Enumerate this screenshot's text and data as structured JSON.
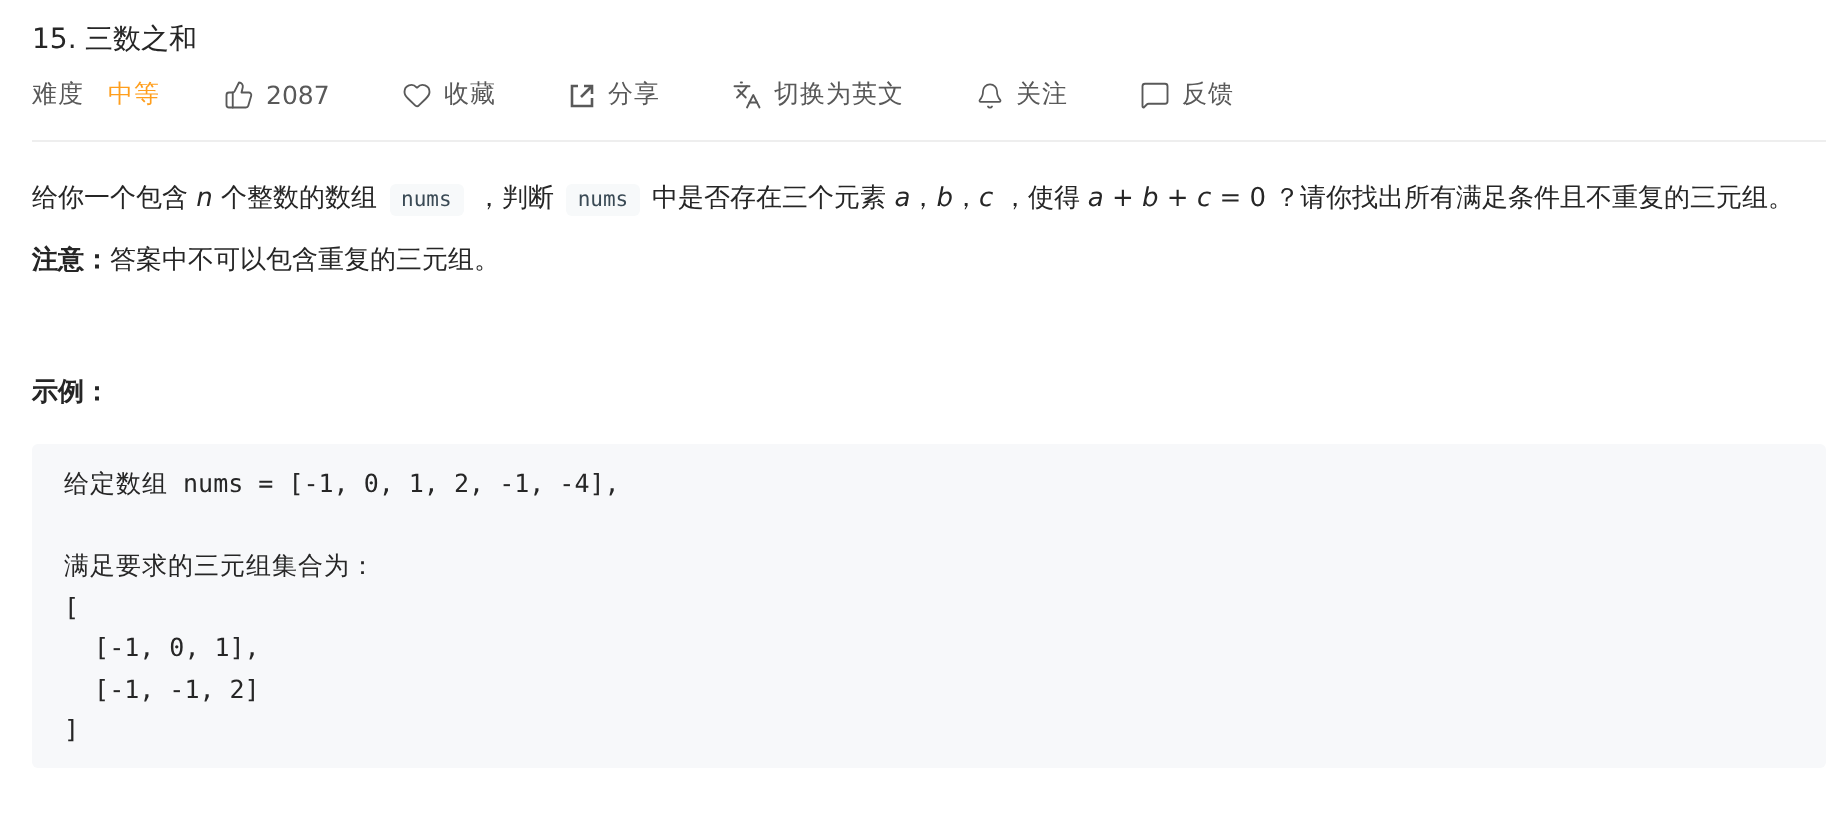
{
  "title": "15. 三数之和",
  "meta": {
    "difficulty_label": "难度",
    "difficulty": "中等",
    "actions": [
      {
        "kind": "like",
        "label": "2087"
      },
      {
        "kind": "favorite",
        "label": "收藏"
      },
      {
        "kind": "share",
        "label": "分享"
      },
      {
        "kind": "translate",
        "label": "切换为英文"
      },
      {
        "kind": "follow",
        "label": "关注"
      },
      {
        "kind": "feedback",
        "label": "反馈"
      }
    ]
  },
  "description": [
    {
      "kind": "text",
      "text": "给你一个包含 *n* 个整数的数组"
    },
    {
      "kind": "code",
      "text": "nums"
    },
    {
      "kind": "text",
      "text": "，判断"
    },
    {
      "kind": "code",
      "text": "nums"
    },
    {
      "kind": "text",
      "text": "中是否存在三个元素 *a*，*b*，*c* ，使得 *a + b + c =* 0 ？请你找出所有满足条件且不重复的三元组。"
    }
  ],
  "note": "**注意：**答案中不可以包含重复的三元组。",
  "example_heading": "示例：",
  "example_code": "给定数组 nums = [-1, 0, 1, 2, -1, -4],\n\n满足要求的三元组集合为：\n[\n  [-1, 0, 1],\n  [-1, -1, 2]\n]"
}
